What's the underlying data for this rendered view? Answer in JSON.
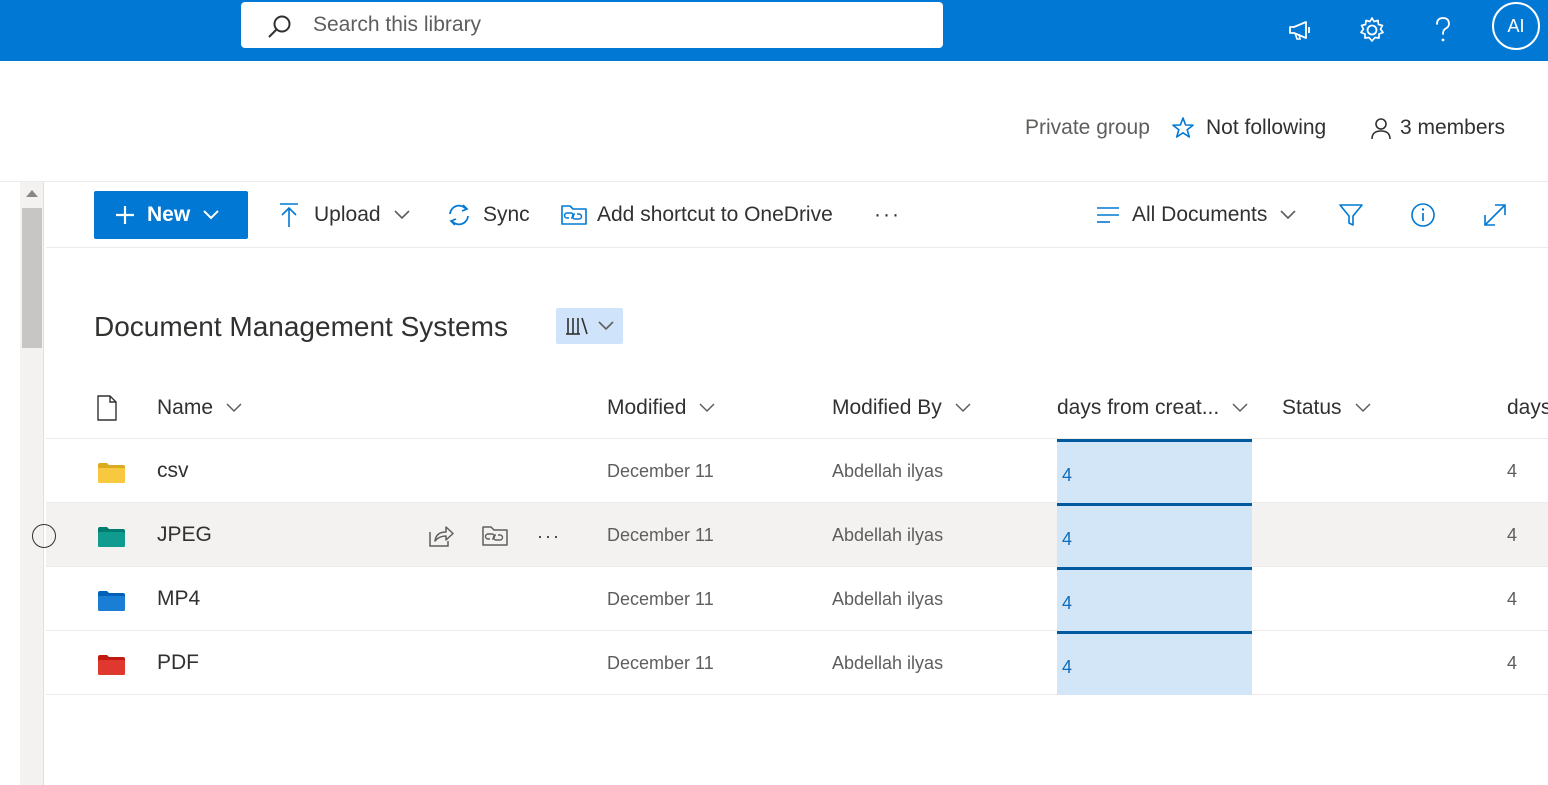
{
  "search": {
    "placeholder": "Search this library"
  },
  "topbar": {
    "icons": [
      "megaphone-icon",
      "gear-icon",
      "help-icon"
    ],
    "avatar_initials": "AI",
    "background": "#0078d4"
  },
  "group": {
    "privacy": "Private group",
    "follow_label": "Not following",
    "members_label": "3 members"
  },
  "commands": {
    "new_label": "New",
    "upload_label": "Upload",
    "sync_label": "Sync",
    "shortcut_label": "Add shortcut to OneDrive",
    "more_label": "···",
    "view_label": "All Documents"
  },
  "library": {
    "title": "Document Management Systems"
  },
  "columns": {
    "name": "Name",
    "modified": "Modified",
    "modified_by": "Modified By",
    "days_from_created": "days from creat...",
    "status": "Status",
    "days_extra": "days"
  },
  "rows": [
    {
      "name": "csv",
      "modified": "December 11",
      "modified_by": "Abdellah ilyas",
      "days": "4",
      "status": "",
      "days2": "4",
      "folder_color": "#f8c93e"
    },
    {
      "name": "JPEG",
      "modified": "December 11",
      "modified_by": "Abdellah ilyas",
      "days": "4",
      "status": "",
      "days2": "4",
      "folder_color": "#0f9b8e"
    },
    {
      "name": "MP4",
      "modified": "December 11",
      "modified_by": "Abdellah ilyas",
      "days": "4",
      "status": "",
      "days2": "4",
      "folder_color": "#1a7fd4"
    },
    {
      "name": "PDF",
      "modified": "December 11",
      "modified_by": "Abdellah ilyas",
      "days": "4",
      "status": "",
      "days2": "4",
      "folder_color": "#e0382e"
    }
  ],
  "row_actions": {
    "more_label": "···"
  }
}
